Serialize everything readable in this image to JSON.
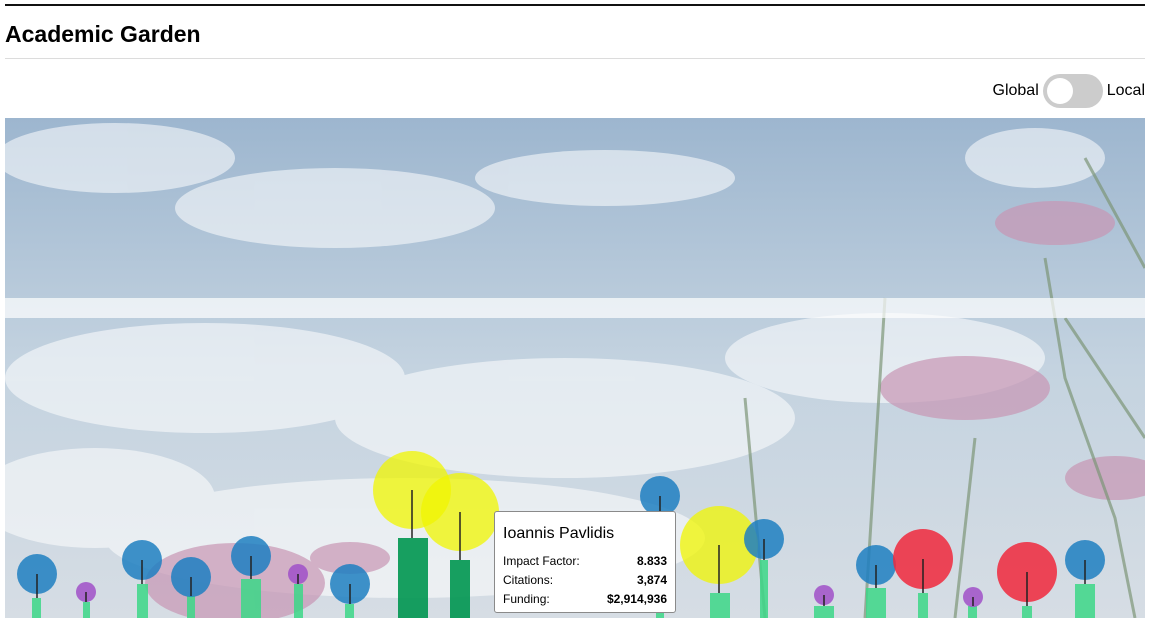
{
  "page": {
    "title": "Academic Garden"
  },
  "view_toggle": {
    "left_label": "Global",
    "right_label": "Local",
    "state": "Global"
  },
  "tooltip": {
    "name": "Ioannis Pavlidis",
    "rows": [
      {
        "label": "Impact Factor:",
        "value": "8.833"
      },
      {
        "label": "Citations:",
        "value": "3,874"
      },
      {
        "label": "Funding:",
        "value": "$2,914,936"
      }
    ]
  },
  "legend_colors": {
    "yellow": "#f0f500",
    "blue": "#1f7fc1",
    "red": "#f0283c",
    "purple": "#a050c8",
    "stem": "#3cd787",
    "stem_dark": "#009650"
  }
}
